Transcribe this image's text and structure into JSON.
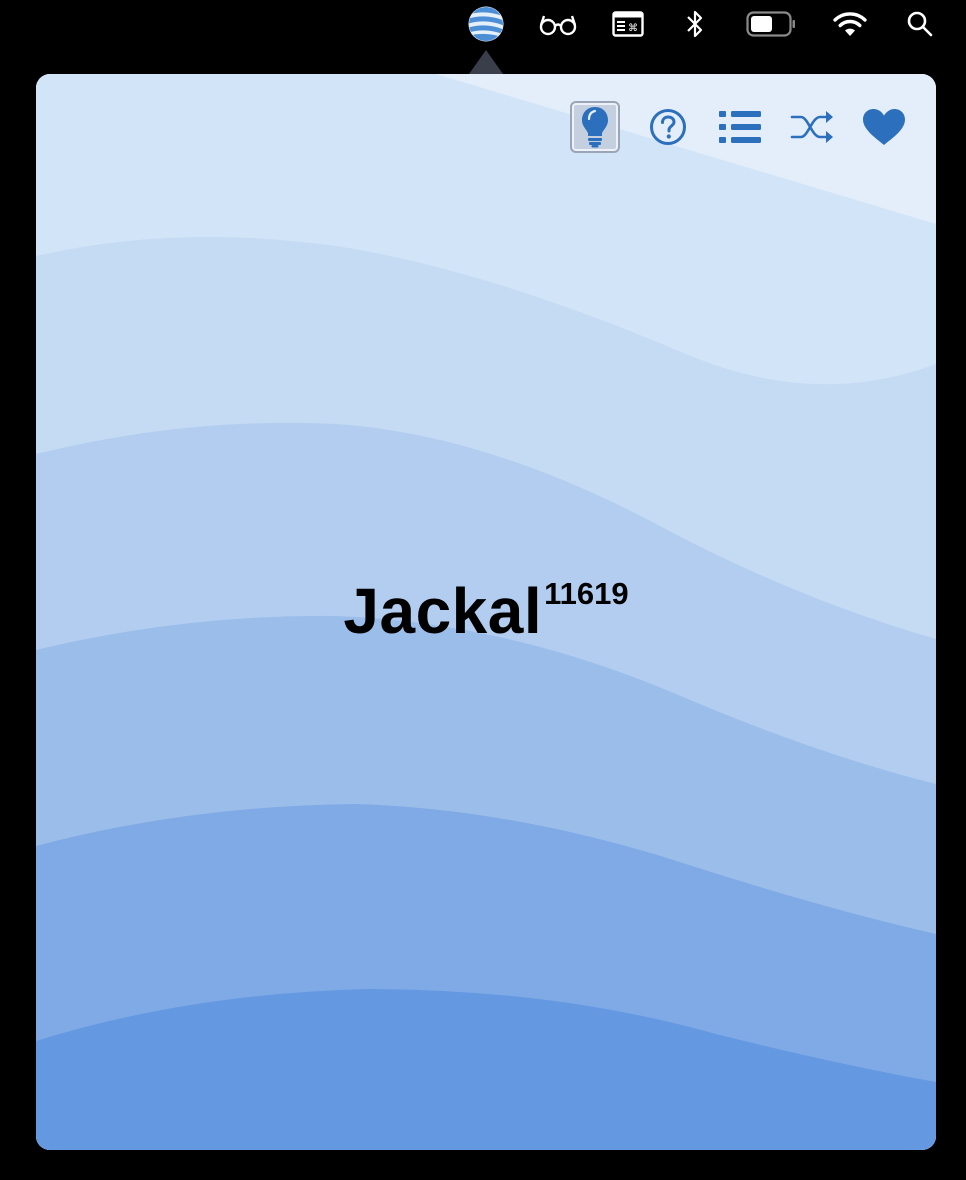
{
  "menubar": {
    "icons": [
      {
        "name": "app-globe-icon",
        "active": true
      },
      {
        "name": "glasses-icon"
      },
      {
        "name": "keyboard-shortcut-icon"
      },
      {
        "name": "bluetooth-icon"
      },
      {
        "name": "battery-icon"
      },
      {
        "name": "wifi-icon"
      },
      {
        "name": "spotlight-search-icon"
      }
    ]
  },
  "popover": {
    "toolbar": [
      {
        "name": "lightbulb-icon",
        "active": true
      },
      {
        "name": "help-icon"
      },
      {
        "name": "list-icon"
      },
      {
        "name": "shuffle-icon"
      },
      {
        "name": "heart-icon"
      }
    ],
    "title": {
      "name": "Jackal",
      "number": "11619"
    },
    "colors": {
      "accent": "#2c6fbd",
      "wave_bands": [
        "#e4eefb",
        "#d2e4f7",
        "#c5dbf3",
        "#b2cdf0",
        "#9bbdea",
        "#80aae5",
        "#6499e2"
      ]
    }
  }
}
